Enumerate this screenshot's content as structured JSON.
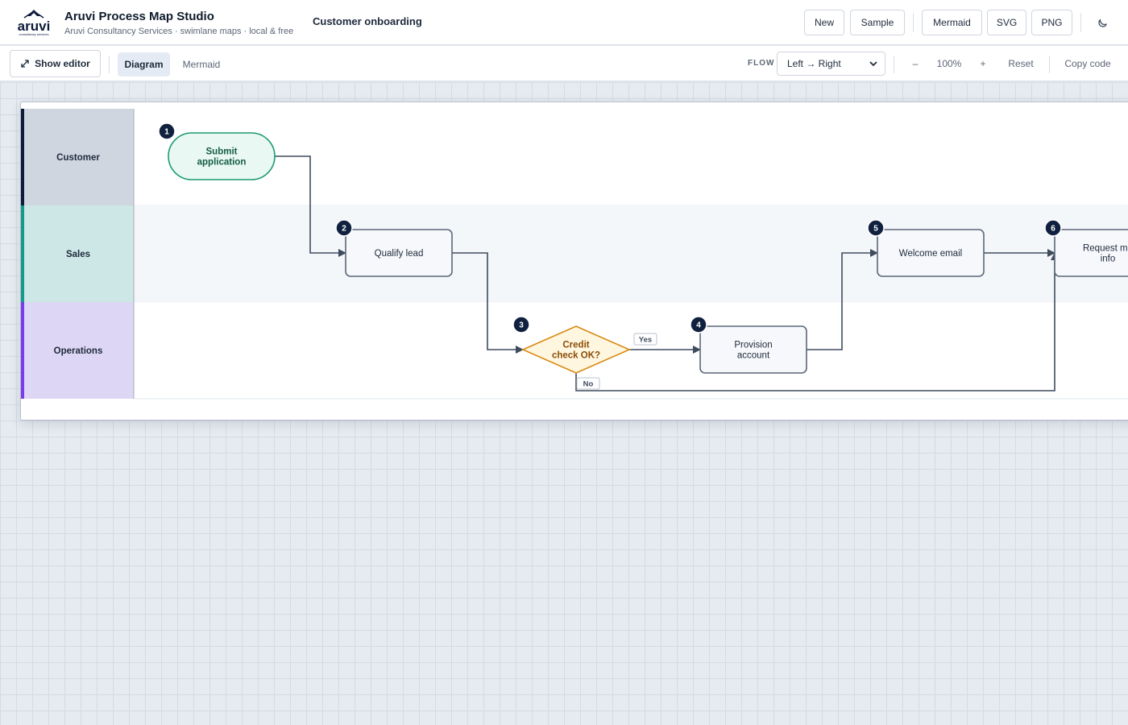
{
  "app": {
    "title": "Aruvi Process Map Studio",
    "subtitle": "Aruvi Consultancy Services · swimlane maps · local & free",
    "logo_text": "aruvi",
    "logo_subtext": "consultancy services",
    "document_title": "Customer onboarding"
  },
  "header_buttons": {
    "new": "New",
    "sample": "Sample",
    "mermaid": "Mermaid",
    "svg": "SVG",
    "png": "PNG",
    "theme_icon": "moon-icon"
  },
  "toolbar": {
    "show_editor": "Show editor",
    "show_editor_icon": "expand-arrows-icon",
    "tabs": [
      {
        "label": "Diagram",
        "active": true
      },
      {
        "label": "Mermaid",
        "active": false
      }
    ],
    "flow_label": "FLOW",
    "flow_value": "Left → Right",
    "zoom_out": "–",
    "zoom_level": "100%",
    "zoom_in": "+",
    "reset": "Reset",
    "copy_code": "Copy code"
  },
  "diagram": {
    "lanes": [
      {
        "name": "Customer",
        "color": "#cfd6e0",
        "accent": "#0f1b3d"
      },
      {
        "name": "Sales",
        "color": "#cde6e6",
        "accent": "#139a8c"
      },
      {
        "name": "Operations",
        "color": "#ddd6f4",
        "accent": "#7c3aed"
      }
    ],
    "nodes": [
      {
        "num": "1",
        "label": [
          "Submit",
          "application"
        ],
        "shape": "terminal",
        "lane": "Customer"
      },
      {
        "num": "2",
        "label": [
          "Qualify lead"
        ],
        "shape": "process",
        "lane": "Sales"
      },
      {
        "num": "3",
        "label": [
          "Credit",
          "check OK?"
        ],
        "shape": "decision",
        "lane": "Operations"
      },
      {
        "num": "4",
        "label": [
          "Provision",
          "account"
        ],
        "shape": "process",
        "lane": "Operations"
      },
      {
        "num": "5",
        "label": [
          "Welcome email"
        ],
        "shape": "process",
        "lane": "Sales"
      },
      {
        "num": "6",
        "label": [
          "Request mo",
          "info"
        ],
        "shape": "process",
        "lane": "Sales"
      }
    ],
    "edge_labels": {
      "yes": "Yes",
      "no": "No"
    },
    "colors": {
      "terminal_fill": "#e9f8f2",
      "terminal_stroke": "#1b9a72",
      "terminal_text": "#145c45",
      "process_fill": "#f6f8fb",
      "process_stroke": "#5b6778",
      "decision_fill": "#fff6e0",
      "decision_stroke": "#d98a12",
      "decision_text": "#8a4d05",
      "badge": "#10213f",
      "edge": "#3f4c5e"
    }
  }
}
